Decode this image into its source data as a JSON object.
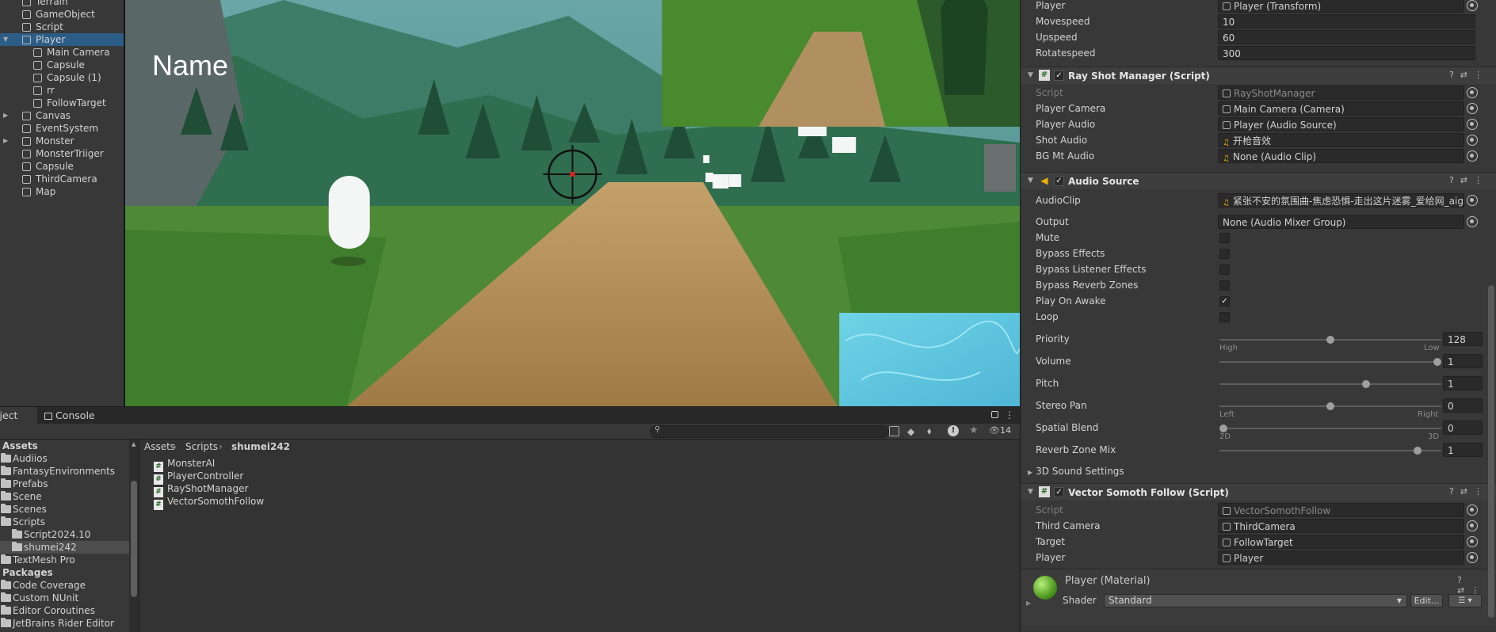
{
  "hierarchy": {
    "items": [
      {
        "label": "Terrain",
        "indent": 0,
        "arrow": false
      },
      {
        "label": "GameObject",
        "indent": 0,
        "arrow": false
      },
      {
        "label": "Script",
        "indent": 0,
        "arrow": false
      },
      {
        "label": "Player",
        "indent": 0,
        "arrow": true,
        "expanded": true,
        "selected": true
      },
      {
        "label": "Main Camera",
        "indent": 1,
        "arrow": false
      },
      {
        "label": "Capsule",
        "indent": 1,
        "arrow": false
      },
      {
        "label": "Capsule (1)",
        "indent": 1,
        "arrow": false
      },
      {
        "label": "rr",
        "indent": 1,
        "arrow": false
      },
      {
        "label": "FollowTarget",
        "indent": 1,
        "arrow": false
      },
      {
        "label": "Canvas",
        "indent": 0,
        "arrow": true
      },
      {
        "label": "EventSystem",
        "indent": 0,
        "arrow": false
      },
      {
        "label": "Monster",
        "indent": 0,
        "arrow": true
      },
      {
        "label": "MonsterTriiger",
        "indent": 0,
        "arrow": false
      },
      {
        "label": "Capsule",
        "indent": 0,
        "arrow": false
      },
      {
        "label": "ThirdCamera",
        "indent": 0,
        "arrow": false
      },
      {
        "label": "Map",
        "indent": 0,
        "arrow": false
      }
    ]
  },
  "game": {
    "name_text": "Name"
  },
  "project": {
    "tab_project": "Project",
    "tab_console": "Console",
    "hidden_count": "14",
    "search_placeholder": "",
    "tree": [
      {
        "label": "Assets",
        "header": true
      },
      {
        "label": "Audiios",
        "indent": 0
      },
      {
        "label": "FantasyEnvironments",
        "indent": 0
      },
      {
        "label": "Prefabs",
        "indent": 0
      },
      {
        "label": "Scene",
        "indent": 0
      },
      {
        "label": "Scenes",
        "indent": 0
      },
      {
        "label": "Scripts",
        "indent": 0,
        "open": true
      },
      {
        "label": "Script2024.10",
        "indent": 1
      },
      {
        "label": "shumei242",
        "indent": 1,
        "selected": true
      },
      {
        "label": "TextMesh Pro",
        "indent": 0
      },
      {
        "label": "Packages",
        "header": true
      },
      {
        "label": "Code Coverage",
        "indent": 0
      },
      {
        "label": "Custom NUnit",
        "indent": 0
      },
      {
        "label": "Editor Coroutines",
        "indent": 0
      },
      {
        "label": "JetBrains Rider Editor",
        "indent": 0
      }
    ],
    "breadcrumb": [
      "Assets",
      "Scripts",
      "shumei242"
    ],
    "files": [
      "MonsterAI",
      "PlayerController",
      "RayShotManager",
      "VectorSomothFollow"
    ]
  },
  "inspector": {
    "top_fields": [
      {
        "label": "Player",
        "value": "Player (Transform)",
        "type": "obj"
      },
      {
        "label": "Movespeed",
        "value": "10",
        "type": "num"
      },
      {
        "label": "Upspeed",
        "value": "60",
        "type": "num"
      },
      {
        "label": "Rotatespeed",
        "value": "300",
        "type": "num"
      }
    ],
    "rayshot": {
      "title": "Ray Shot Manager (Script)",
      "fields": [
        {
          "label": "Script",
          "value": "RayShotManager",
          "dim": true
        },
        {
          "label": "Player Camera",
          "value": "Main Camera (Camera)"
        },
        {
          "label": "Player Audio",
          "value": "Player (Audio Source)"
        },
        {
          "label": "Shot Audio",
          "value": "开枪音效"
        },
        {
          "label": "BG Mt Audio",
          "value": "None (Audio Clip)"
        }
      ]
    },
    "audio": {
      "title": "Audio Source",
      "audioclip_label": "AudioClip",
      "audioclip_value": "紧张不安的氛围曲-焦虑恐惧-走出这片迷雾_爱给网_aige",
      "output_label": "Output",
      "output_value": "None (Audio Mixer Group)",
      "toggles": [
        {
          "label": "Mute",
          "checked": false
        },
        {
          "label": "Bypass Effects",
          "checked": false
        },
        {
          "label": "Bypass Listener Effects",
          "checked": false
        },
        {
          "label": "Bypass Reverb Zones",
          "checked": false
        },
        {
          "label": "Play On Awake",
          "checked": true
        },
        {
          "label": "Loop",
          "checked": false
        }
      ],
      "sliders": [
        {
          "label": "Priority",
          "value": "128",
          "fraction": 0.5,
          "min_cap": "High",
          "max_cap": "Low"
        },
        {
          "label": "Volume",
          "value": "1",
          "fraction": 1.0
        },
        {
          "label": "Pitch",
          "value": "1",
          "fraction": 0.666
        },
        {
          "label": "Stereo Pan",
          "value": "0",
          "fraction": 0.5,
          "min_cap": "Left",
          "max_cap": "Right"
        },
        {
          "label": "Spatial Blend",
          "value": "0",
          "fraction": 0.0,
          "min_cap": "2D",
          "max_cap": "3D"
        },
        {
          "label": "Reverb Zone Mix",
          "value": "1",
          "fraction": 0.909
        }
      ],
      "sound_settings": "3D Sound Settings"
    },
    "follow": {
      "title": "Vector Somoth Follow (Script)",
      "fields": [
        {
          "label": "Script",
          "value": "VectorSomothFollow",
          "dim": true
        },
        {
          "label": "Third Camera",
          "value": "ThirdCamera"
        },
        {
          "label": "Target",
          "value": "FollowTarget"
        },
        {
          "label": "Player",
          "value": "Player"
        }
      ]
    },
    "material": {
      "title": "Player (Material)",
      "shader_label": "Shader",
      "shader_value": "Standard",
      "edit_label": "Edit..."
    }
  }
}
